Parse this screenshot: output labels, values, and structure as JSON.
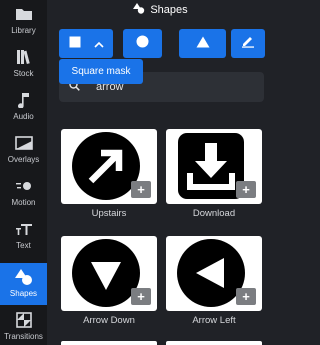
{
  "sidebar": {
    "items": [
      {
        "label": "Library",
        "icon": "folder-icon"
      },
      {
        "label": "Stock",
        "icon": "stock-books-icon"
      },
      {
        "label": "Audio",
        "icon": "music-note-icon"
      },
      {
        "label": "Overlays",
        "icon": "overlay-icon"
      },
      {
        "label": "Motion",
        "icon": "motion-icon"
      },
      {
        "label": "Text",
        "icon": "text-icon"
      },
      {
        "label": "Shapes",
        "icon": "shapes-icon",
        "active": true
      },
      {
        "label": "Transitions",
        "icon": "transitions-icon"
      }
    ]
  },
  "panel": {
    "title": "Shapes"
  },
  "toolbar": {
    "tooltip": "Square mask"
  },
  "search": {
    "value": "arrow"
  },
  "shapes": [
    {
      "label": "Upstairs",
      "icon": "upstairs-arrow-icon"
    },
    {
      "label": "Download",
      "icon": "download-icon"
    },
    {
      "label": "Arrow Down",
      "icon": "arrow-down-icon"
    },
    {
      "label": "Arrow Left",
      "icon": "arrow-left-icon"
    }
  ],
  "add_label": "+",
  "colors": {
    "accent": "#1a73e8",
    "sidebar": "#17181b",
    "panel": "#202227"
  }
}
